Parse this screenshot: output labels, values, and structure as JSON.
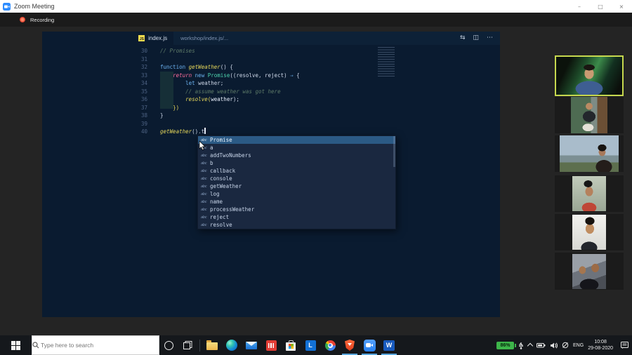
{
  "window": {
    "title": "Zoom Meeting",
    "controls": {
      "minimize": "–",
      "maximize": "□",
      "close": "×"
    }
  },
  "meeting": {
    "recording_label": "Recording"
  },
  "editor": {
    "tab": {
      "file_icon": "JS",
      "file_name": "index.js",
      "breadcrumb": "workshop/index.js/..."
    },
    "actions": [
      {
        "name": "compare-changes-icon",
        "glyph": "⇆"
      },
      {
        "name": "split-editor-icon",
        "glyph": "◫"
      },
      {
        "name": "more-actions-icon",
        "glyph": "⋯"
      }
    ],
    "code_lines": [
      {
        "num": 30,
        "segments": [
          {
            "t": "// Promises",
            "c": "cm"
          }
        ]
      },
      {
        "num": 31,
        "segments": []
      },
      {
        "num": 32,
        "segments": [
          {
            "t": "function ",
            "c": "kw"
          },
          {
            "t": "getWeather",
            "c": "fn"
          },
          {
            "t": "() {",
            "c": "pu"
          }
        ]
      },
      {
        "num": 33,
        "segments": [
          {
            "t": "    ",
            "c": "pu"
          },
          {
            "t": "return",
            "c": "ret"
          },
          {
            "t": " ",
            "c": "pu"
          },
          {
            "t": "new",
            "c": "kw"
          },
          {
            "t": " ",
            "c": "pu"
          },
          {
            "t": "Promise",
            "c": "cls"
          },
          {
            "t": "((resolve, reject) ",
            "c": "pu"
          },
          {
            "t": "⇒",
            "c": "kw"
          },
          {
            "t": " {",
            "c": "pu"
          }
        ]
      },
      {
        "num": 34,
        "segments": [
          {
            "t": "        ",
            "c": "pu"
          },
          {
            "t": "let",
            "c": "kw"
          },
          {
            "t": " weather;",
            "c": "pu"
          }
        ]
      },
      {
        "num": 35,
        "segments": [
          {
            "t": "        ",
            "c": "pu"
          },
          {
            "t": "// assume weather was got here",
            "c": "cm"
          }
        ]
      },
      {
        "num": 36,
        "segments": [
          {
            "t": "        ",
            "c": "pu"
          },
          {
            "t": "resolve",
            "c": "fn"
          },
          {
            "t": "(",
            "c": "yl"
          },
          {
            "t": "weather",
            "c": "tx"
          },
          {
            "t": ");",
            "c": "pu"
          }
        ]
      },
      {
        "num": 37,
        "segments": [
          {
            "t": "    ",
            "c": "pu"
          },
          {
            "t": "})",
            "c": "yl"
          }
        ]
      },
      {
        "num": 38,
        "segments": [
          {
            "t": "}",
            "c": "pu"
          }
        ]
      },
      {
        "num": 39,
        "segments": []
      },
      {
        "num": 40,
        "segments": [
          {
            "t": "getWeather",
            "c": "fn"
          },
          {
            "t": "().t",
            "c": "pu"
          }
        ],
        "cursor": true
      }
    ],
    "suggestions": {
      "selected_index": 0,
      "items": [
        {
          "icon": "abc",
          "label": "Promise"
        },
        {
          "icon": "abc",
          "label": "a"
        },
        {
          "icon": "abc",
          "label": "addTwoNumbers"
        },
        {
          "icon": "abc",
          "label": "b"
        },
        {
          "icon": "abc",
          "label": "callback"
        },
        {
          "icon": "abc",
          "label": "console"
        },
        {
          "icon": "abc",
          "label": "getWeather"
        },
        {
          "icon": "abc",
          "label": "log"
        },
        {
          "icon": "abc",
          "label": "name"
        },
        {
          "icon": "abc",
          "label": "processWeather"
        },
        {
          "icon": "abc",
          "label": "reject"
        },
        {
          "icon": "abc",
          "label": "resolve"
        }
      ]
    }
  },
  "participants": {
    "tiles": [
      {
        "name": "participant-video-1",
        "photo": "ph1",
        "active": true
      },
      {
        "name": "participant-video-2",
        "photo": "ph2",
        "active": false
      },
      {
        "name": "participant-video-3",
        "photo": "ph3",
        "active": false
      },
      {
        "name": "participant-video-4",
        "photo": "ph4",
        "active": false
      },
      {
        "name": "participant-video-5",
        "photo": "ph5",
        "active": false
      },
      {
        "name": "participant-video-6",
        "photo": "ph6",
        "active": false
      }
    ]
  },
  "taskbar": {
    "search": {
      "placeholder": "Type here to search"
    },
    "apps": [
      {
        "name": "file-explorer"
      },
      {
        "name": "edge"
      },
      {
        "name": "mail"
      },
      {
        "name": "red-bars-app"
      },
      {
        "name": "microsoft-store"
      },
      {
        "name": "l-app",
        "letter": "L"
      },
      {
        "name": "chrome"
      },
      {
        "name": "brave"
      },
      {
        "name": "zoom"
      },
      {
        "name": "word",
        "letter": "W"
      }
    ],
    "running_apps": [
      "brave",
      "zoom",
      "word"
    ],
    "tray": {
      "battery_percent": "86%",
      "language": "ENG",
      "time": "10:08",
      "date": "29-08-2020"
    }
  },
  "colors": {
    "accent_blue": "#2d8cff",
    "active_speaker_border": "#c6d84e",
    "battery_green": "#3db54a",
    "editor_background": "#0a1b30",
    "suggest_selected": "#2b5a85"
  }
}
